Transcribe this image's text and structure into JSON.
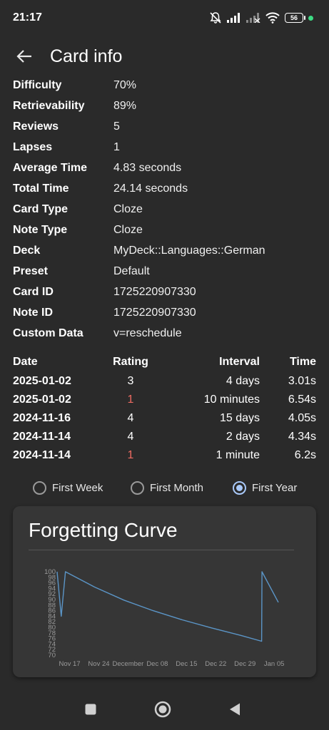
{
  "status_bar": {
    "time": "21:17",
    "battery": "56",
    "icons": [
      "mute-icon",
      "signal-icon",
      "signal-off-icon",
      "wifi-icon",
      "battery-icon"
    ]
  },
  "app_bar": {
    "title": "Card info",
    "back_icon": "arrow-left-icon"
  },
  "info": [
    {
      "label": "Difficulty",
      "value": "70%"
    },
    {
      "label": "Retrievability",
      "value": "89%"
    },
    {
      "label": "Reviews",
      "value": "5"
    },
    {
      "label": "Lapses",
      "value": "1"
    },
    {
      "label": "Average Time",
      "value": "4.83 seconds"
    },
    {
      "label": "Total Time",
      "value": "24.14 seconds"
    },
    {
      "label": "Card Type",
      "value": "Cloze"
    },
    {
      "label": "Note Type",
      "value": "Cloze"
    },
    {
      "label": "Deck",
      "value": "MyDeck::Languages::German"
    },
    {
      "label": "Preset",
      "value": "Default"
    },
    {
      "label": "Card ID",
      "value": "1725220907330"
    },
    {
      "label": "Note ID",
      "value": "1725220907330"
    },
    {
      "label": "Custom Data",
      "value": "v=reschedule"
    }
  ],
  "reviews": {
    "headers": {
      "date": "Date",
      "rating": "Rating",
      "interval": "Interval",
      "time": "Time"
    },
    "rows": [
      {
        "date": "2025-01-02",
        "rating": "3",
        "interval": "4 days",
        "time": "3.01s",
        "lapse": false
      },
      {
        "date": "2025-01-02",
        "rating": "1",
        "interval": "10 minutes",
        "time": "6.54s",
        "lapse": true
      },
      {
        "date": "2024-11-16",
        "rating": "4",
        "interval": "15 days",
        "time": "4.05s",
        "lapse": false
      },
      {
        "date": "2024-11-14",
        "rating": "4",
        "interval": "2 days",
        "time": "4.34s",
        "lapse": false
      },
      {
        "date": "2024-11-14",
        "rating": "1",
        "interval": "1 minute",
        "time": "6.2s",
        "lapse": true
      }
    ]
  },
  "range_options": {
    "options": [
      "First Week",
      "First Month",
      "First Year"
    ],
    "selected": "First Year"
  },
  "colors": {
    "background": "#2a2a2a",
    "card": "#363636",
    "curve": "#5b95c7",
    "lapse_rating": "#ee6b62",
    "radio_selected": "#a8c8f8"
  },
  "chart_data": {
    "type": "line",
    "title": "Forgetting Curve",
    "xlabel": "",
    "ylabel": "",
    "ylim": [
      70,
      100
    ],
    "y_ticks": [
      "100",
      "98",
      "96",
      "94",
      "92",
      "90",
      "88",
      "86",
      "84",
      "82",
      "80",
      "78",
      "76",
      "74",
      "72",
      "70"
    ],
    "x_ticks": [
      {
        "label": "Nov 17",
        "date": "2024-11-17"
      },
      {
        "label": "Nov 24",
        "date": "2024-11-24"
      },
      {
        "label": "December",
        "date": "2024-12-01"
      },
      {
        "label": "Dec 08",
        "date": "2024-12-08"
      },
      {
        "label": "Dec 15",
        "date": "2024-12-15"
      },
      {
        "label": "Dec 22",
        "date": "2024-12-22"
      },
      {
        "label": "Dec 29",
        "date": "2024-12-29"
      },
      {
        "label": "Jan 05",
        "date": "2025-01-05"
      }
    ],
    "series": [
      {
        "points": [
          {
            "x": "2024-11-14",
            "y": 100
          },
          {
            "x": "2024-11-15",
            "y": 84
          },
          {
            "x": "2024-11-16",
            "y": 100
          },
          {
            "x": "2024-11-23",
            "y": 94.5
          },
          {
            "x": "2024-11-30",
            "y": 89.8
          },
          {
            "x": "2024-12-07",
            "y": 86
          },
          {
            "x": "2024-12-14",
            "y": 82.7
          },
          {
            "x": "2024-12-21",
            "y": 79.8
          },
          {
            "x": "2024-12-28",
            "y": 77.1
          },
          {
            "x": "2025-01-02",
            "y": 75
          },
          {
            "x": "2025-01-02",
            "y": 100
          },
          {
            "x": "2025-01-06",
            "y": 89
          }
        ]
      }
    ]
  },
  "nav_bar": {
    "icons": [
      "recents-square-icon",
      "home-circle-icon",
      "back-triangle-icon"
    ]
  }
}
